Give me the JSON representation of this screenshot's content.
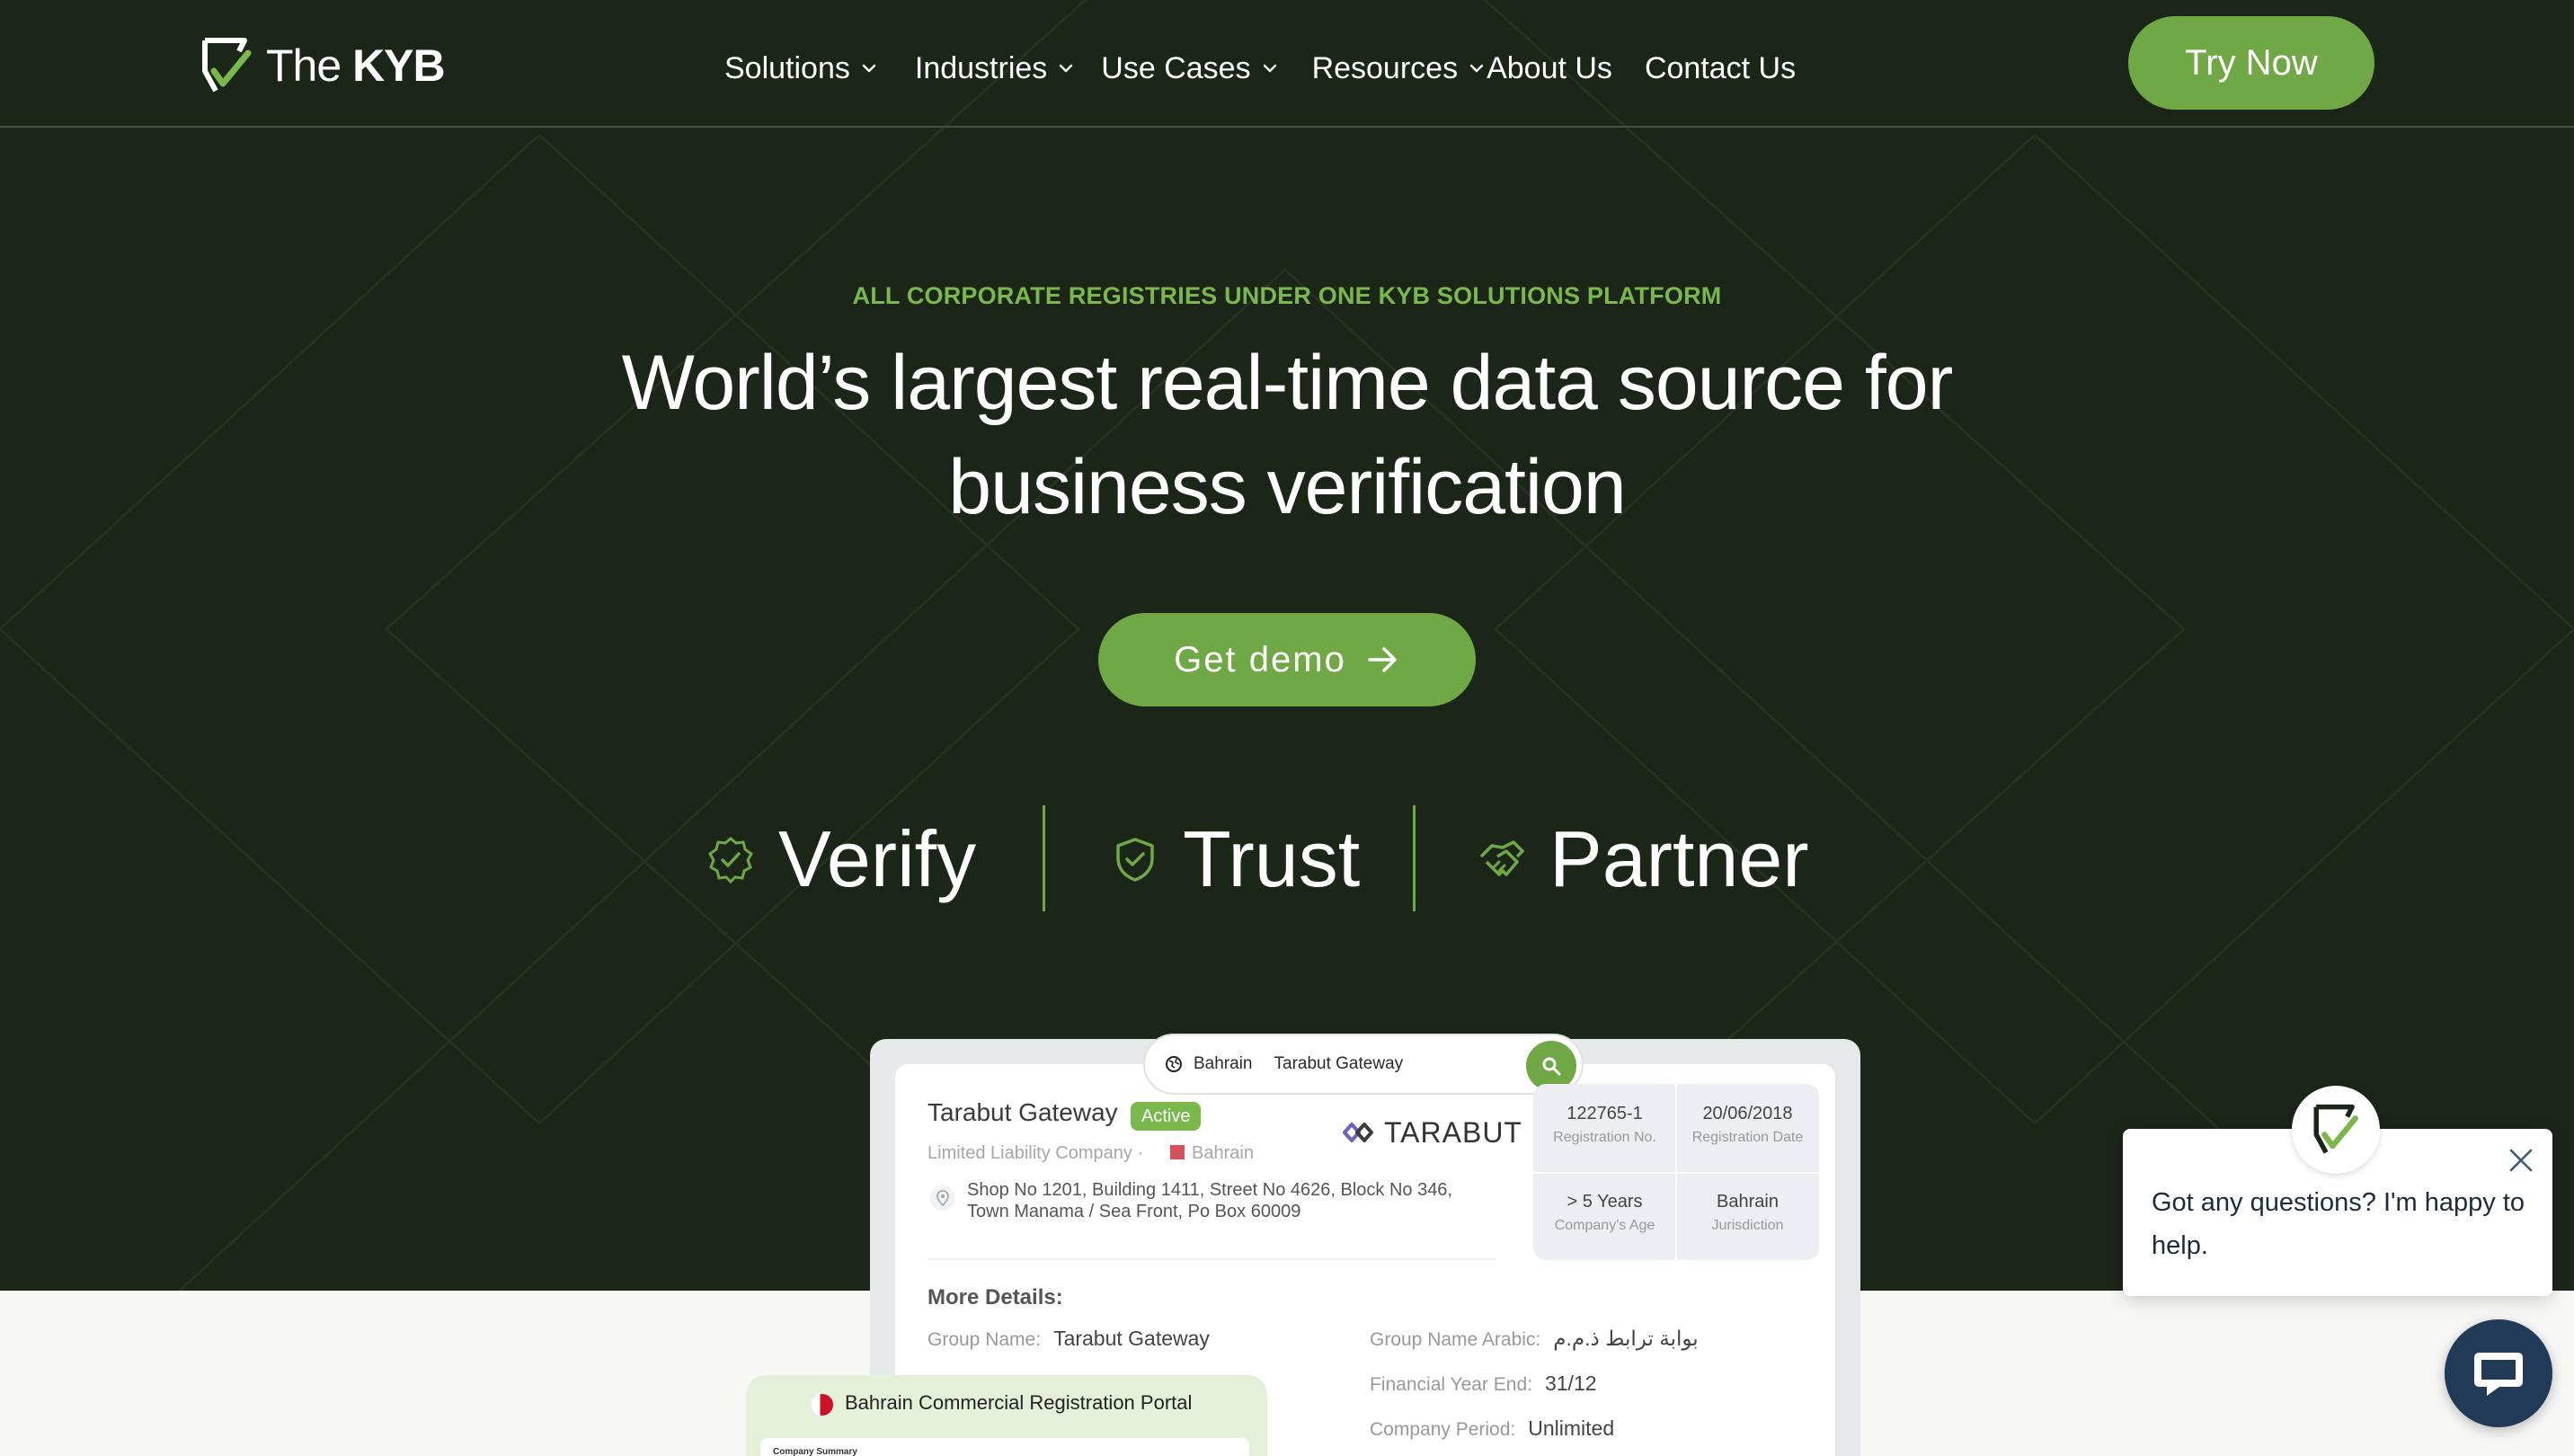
{
  "brand": {
    "logo_light": "The",
    "logo_bold": "KYB",
    "accent": "#6fa844",
    "hero_bg": "#1b2619"
  },
  "nav": {
    "items": [
      {
        "label": "Solutions",
        "dropdown": true
      },
      {
        "label": "Industries",
        "dropdown": true
      },
      {
        "label": "Use Cases",
        "dropdown": true
      },
      {
        "label": "Resources",
        "dropdown": true
      },
      {
        "label": "About Us",
        "dropdown": false
      },
      {
        "label": "Contact Us",
        "dropdown": false
      }
    ],
    "cta_label": "Try Now"
  },
  "hero": {
    "eyebrow": "ALL CORPORATE REGISTRIES UNDER ONE KYB SOLUTIONS PLATFORM",
    "headline_line1": "World’s largest real-time data source for",
    "headline_line2": "business verification",
    "cta_label": "Get demo",
    "pillars": [
      {
        "label": "Verify",
        "icon": "badge-check-icon"
      },
      {
        "label": "Trust",
        "icon": "shield-check-icon"
      },
      {
        "label": "Partner",
        "icon": "handshake-icon"
      }
    ]
  },
  "preview": {
    "search": {
      "country": "Bahrain",
      "query": "Tarabut Gateway"
    },
    "company": {
      "name": "Tarabut Gateway",
      "status": "Active",
      "type": "Limited Liability Company",
      "type_separator": "·",
      "country": "Bahrain",
      "address": "Shop No 1201, Building 1411, Street No 4626, Block No 346, Town Manama / Sea Front, Po Box 60009",
      "logo_text": "TARABUT"
    },
    "stats": [
      {
        "value": "122765-1",
        "label": "Registration No."
      },
      {
        "value": "20/06/2018",
        "label": "Registration Date"
      },
      {
        "value": "> 5 Years",
        "label": "Company's Age"
      },
      {
        "value": "Bahrain",
        "label": "Jurisdiction"
      }
    ],
    "more_title": "More Details:",
    "details": [
      {
        "key": "Group Name:",
        "value": "Tarabut Gateway"
      },
      {
        "key": "Group Name Arabic:",
        "value": "بوابة ترابط ذ.م.م"
      },
      {
        "key": "Financial Year End:",
        "value": "31/12"
      },
      {
        "key": "Company Period:",
        "value": "Unlimited"
      }
    ],
    "portal": {
      "title": "Bahrain Commercial Registration Portal",
      "sheet_label": "Company Summary"
    }
  },
  "chat": {
    "message": "Got any questions? I'm happy to help.",
    "launcher_icon": "chat-bubble-icon",
    "close_icon": "close-icon"
  }
}
